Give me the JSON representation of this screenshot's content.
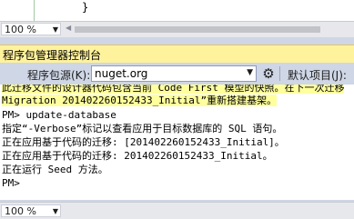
{
  "editor": {
    "code_line": "}"
  },
  "top_zoom": {
    "value": "100 %"
  },
  "package_manager": {
    "title": "程序包管理器控制台",
    "source_label": "程序包源(K):",
    "source_value": "nuget.org",
    "default_project_label": "默认项目(J):",
    "console_lines": [
      {
        "text": "此迁移文件的设计器代码包含当前 Code First 模型的快照。在下一次迁移",
        "highlight": true
      },
      {
        "text": "Migration 201402260152433_Initial”重新搭建基架。",
        "highlight": true
      },
      {
        "text": "PM> update-database",
        "highlight": false
      },
      {
        "text": "指定“-Verbose”标记以查看应用于目标数据库的 SQL 语句。",
        "highlight": false
      },
      {
        "text": "正在应用基于代码的迁移: [201402260152433_Initial]。",
        "highlight": false
      },
      {
        "text": "正在应用基于代码的迁移: 201402260152433_Initial。",
        "highlight": false
      },
      {
        "text": "正在运行 Seed 方法。",
        "highlight": false
      },
      {
        "text": "PM>",
        "highlight": false
      }
    ]
  },
  "bottom_zoom": {
    "value": "100 %"
  }
}
